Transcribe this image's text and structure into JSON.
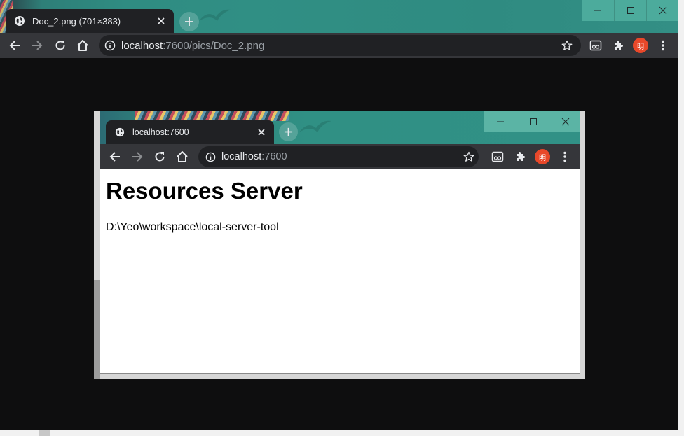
{
  "outer": {
    "tab_title": "Doc_2.png (701×383)",
    "url_host": "localhost",
    "url_rest": ":7600/pics/Doc_2.png",
    "avatar_text": "明",
    "icons": [
      "globe-icon",
      "close-icon",
      "plus-icon",
      "back-icon",
      "forward-icon",
      "reload-icon",
      "home-icon",
      "info-icon",
      "star-icon",
      "extension-cast-icon",
      "puzzle-icon",
      "more-icon",
      "minimize-icon",
      "maximize-icon",
      "window-close-icon"
    ]
  },
  "inner": {
    "tab_title": "localhost:7600",
    "url_host": "localhost",
    "url_rest": ":7600",
    "avatar_text": "明",
    "page": {
      "heading": "Resources Server",
      "path": "D:\\Yeo\\workspace\\local-server-tool"
    }
  },
  "colors": {
    "titlebar_teal": "#2f8c82",
    "toolbar": "#35363a",
    "tab": "#202124",
    "avatar": "#e8482a",
    "viewer_bg": "#0e0e0f"
  }
}
